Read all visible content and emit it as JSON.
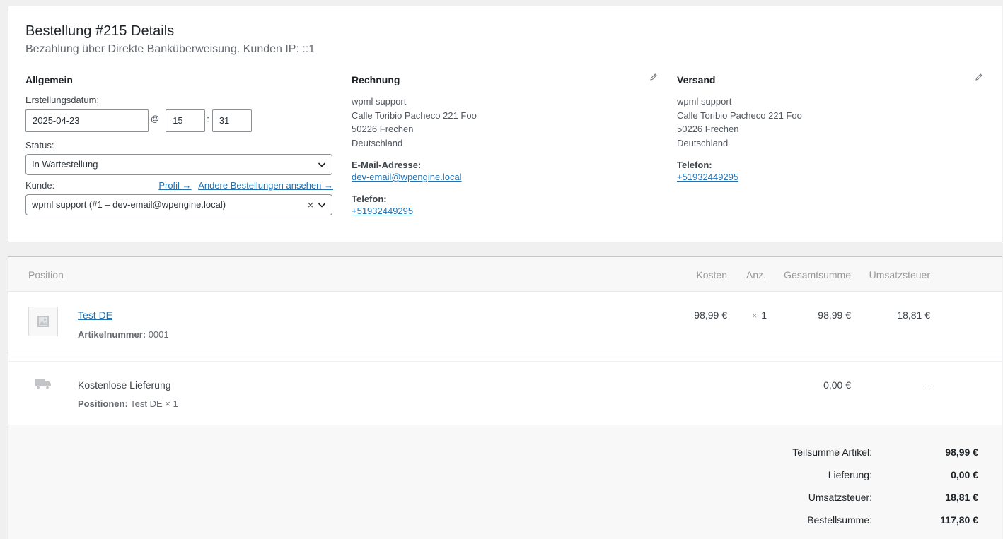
{
  "header": {
    "title": "Bestellung #215 Details",
    "subtitle": "Bezahlung über Direkte Banküberweisung. Kunden IP: ::1"
  },
  "general": {
    "heading": "Allgemein",
    "date_label": "Erstellungsdatum:",
    "date_value": "2025-04-23",
    "at": "@",
    "hour": "15",
    "colon": ":",
    "minute": "31",
    "status_label": "Status:",
    "status_value": "In Wartestellung",
    "customer_label": "Kunde:",
    "profile_link": "Profil →",
    "other_orders_link": "Andere Bestellungen ansehen →",
    "customer_value": "wpml support (#1 – dev-email@wpengine.local)",
    "clear": "×"
  },
  "billing": {
    "heading": "Rechnung",
    "name": "wpml support",
    "street": "Calle Toribio Pacheco 221 Foo",
    "city": "50226 Frechen",
    "country": "Deutschland",
    "email_label": "E-Mail-Adresse:",
    "email": "dev-email@wpengine.local",
    "phone_label": "Telefon:",
    "phone": "+51932449295"
  },
  "shipping": {
    "heading": "Versand",
    "name": "wpml support",
    "street": "Calle Toribio Pacheco 221 Foo",
    "city": "50226 Frechen",
    "country": "Deutschland",
    "phone_label": "Telefon:",
    "phone": "+51932449295"
  },
  "items_table": {
    "headers": {
      "position": "Position",
      "cost": "Kosten",
      "qty": "Anz.",
      "total": "Gesamtsumme",
      "tax": "Umsatzsteuer"
    },
    "product": {
      "name": "Test DE",
      "sku_label": "Artikelnummer:",
      "sku": "0001",
      "cost": "98,99 €",
      "qty_prefix": "×",
      "qty": "1",
      "total": "98,99 €",
      "tax": "18,81 €"
    },
    "shipping_line": {
      "name": "Kostenlose Lieferung",
      "items_label": "Positionen:",
      "items": "Test DE × 1",
      "total": "0,00 €",
      "tax": "–"
    }
  },
  "totals": {
    "subtotal_label": "Teilsumme Artikel:",
    "subtotal": "98,99 €",
    "shipping_label": "Lieferung:",
    "shipping": "0,00 €",
    "tax_label": "Umsatzsteuer:",
    "tax": "18,81 €",
    "order_total_label": "Bestellsumme:",
    "order_total": "117,80 €"
  },
  "icons": {
    "edit": "pencil-icon",
    "product_placeholder": "image-placeholder-icon",
    "shipping": "truck-icon",
    "dropdown": "chevron-down-icon"
  }
}
